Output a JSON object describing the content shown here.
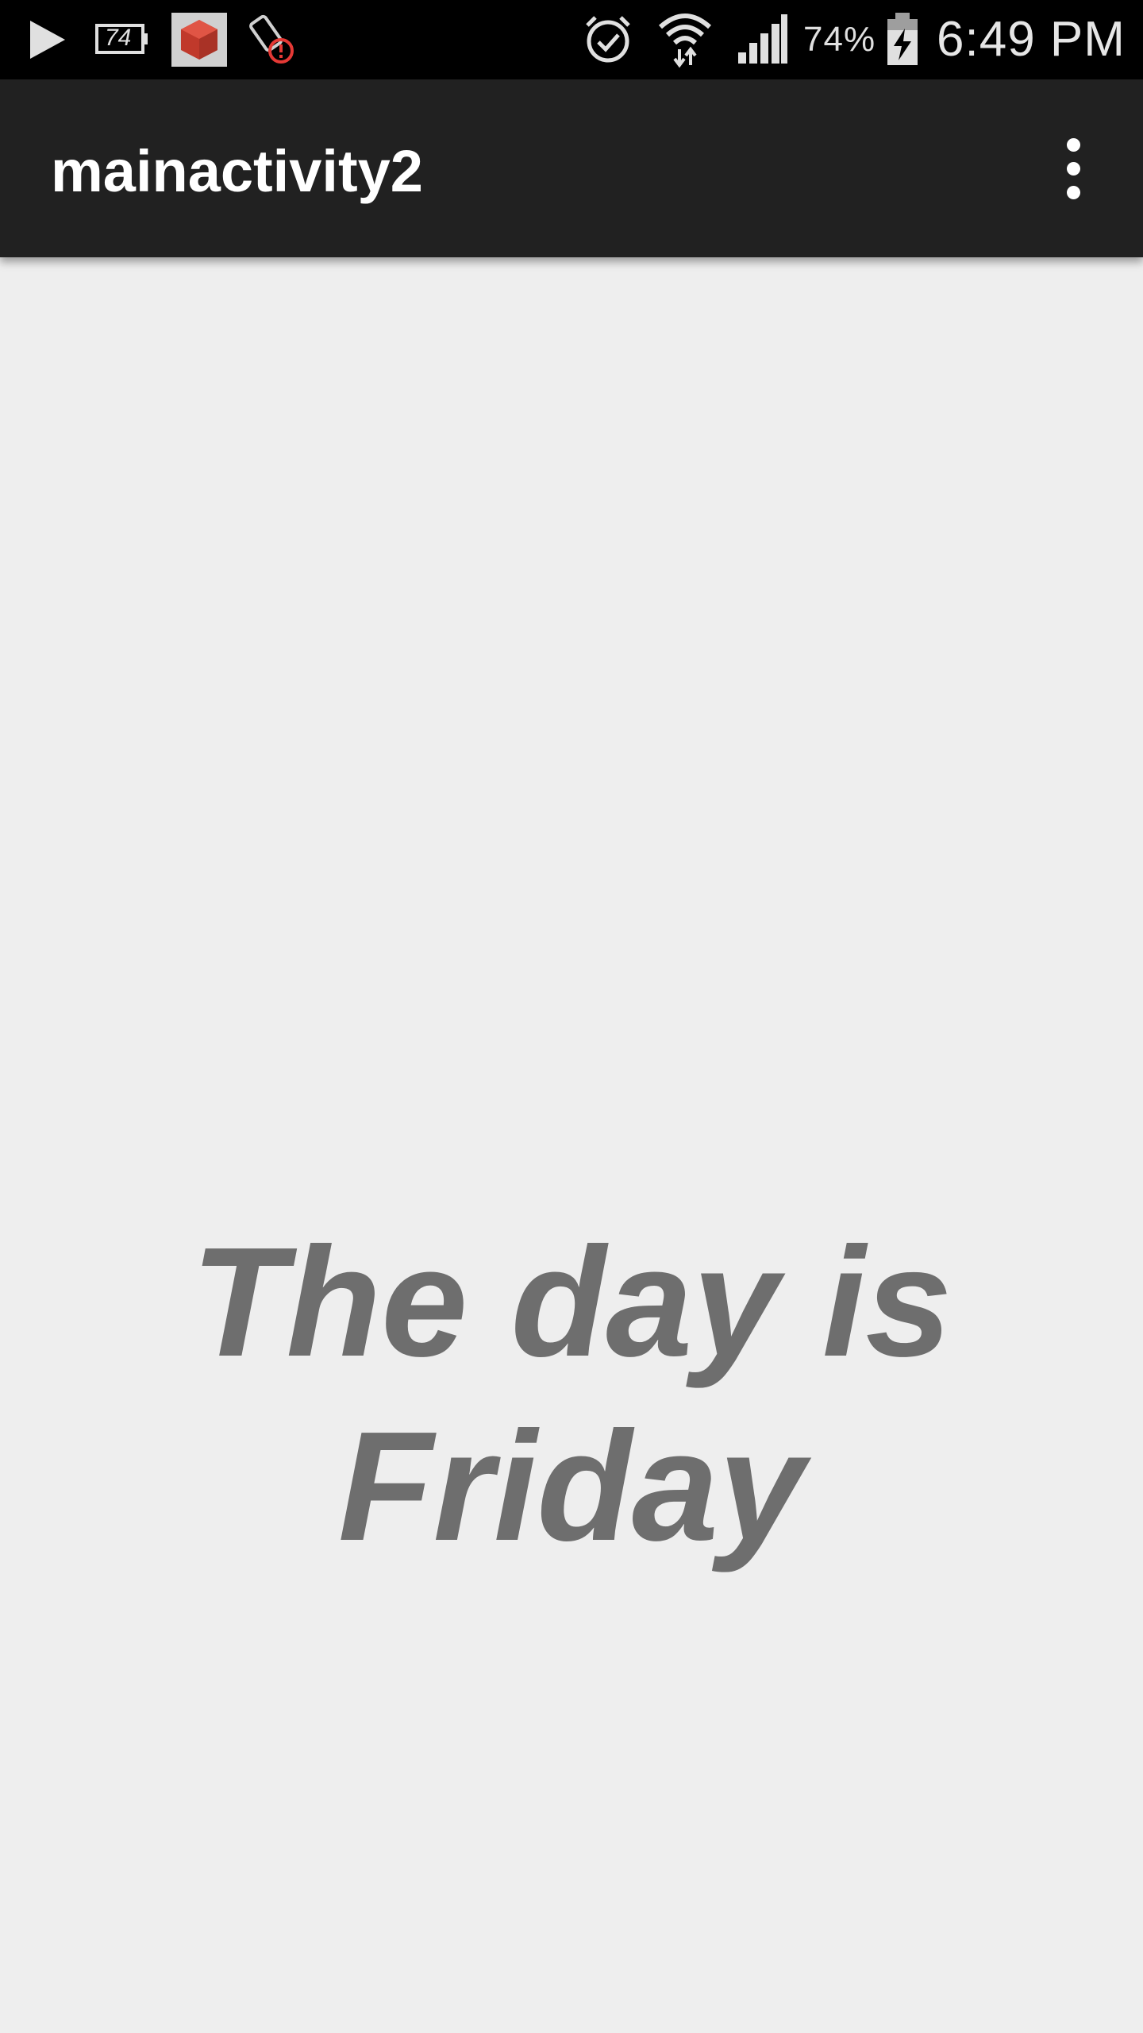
{
  "status_bar": {
    "notification_icons": [
      "play-store-icon",
      "battery-74-icon",
      "red-cube-app-icon",
      "battery-warning-icon"
    ],
    "system_icons": [
      "alarm-icon",
      "wifi-icon",
      "cellular-signal-icon",
      "battery-charging-icon"
    ],
    "battery_percent": "74%",
    "time": "6:49 PM",
    "battery_badge_label": "74"
  },
  "app_bar": {
    "title": "mainactivity2",
    "menu_icon": "more-vert-icon"
  },
  "main": {
    "message": "The day is Friday"
  },
  "colors": {
    "status_bar_bg": "#000000",
    "app_bar_bg": "#212121",
    "content_bg": "#eeeeee",
    "message_text": "#6e6e6e"
  }
}
